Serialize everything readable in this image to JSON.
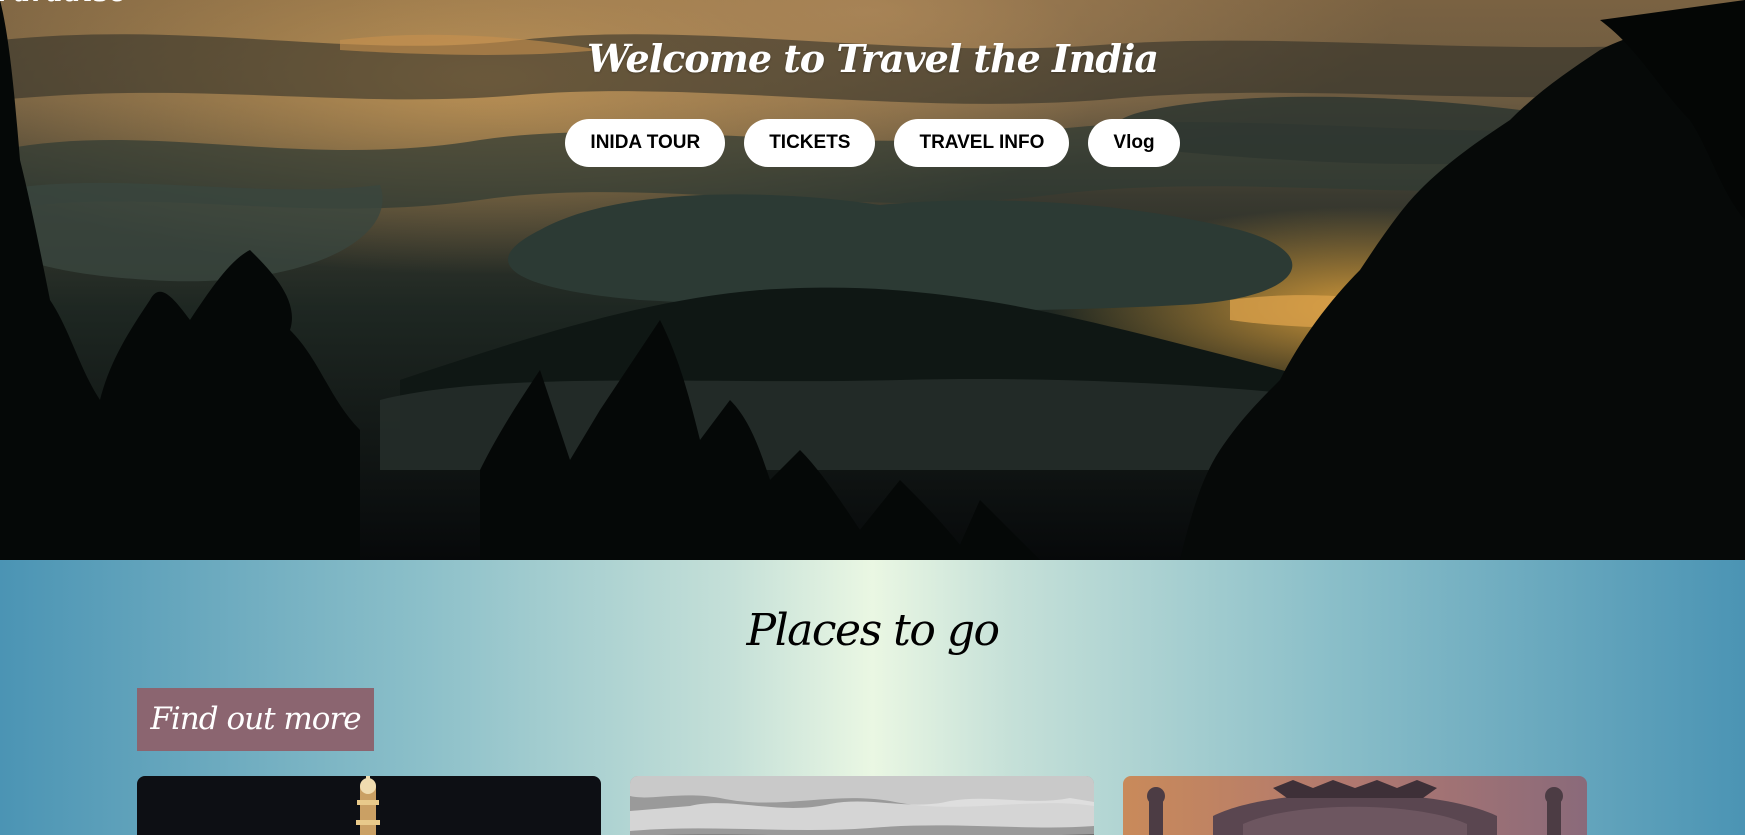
{
  "header": {
    "brand_fragment": "Paradise",
    "title": "Welcome to Travel the India"
  },
  "nav": {
    "items": [
      {
        "label": "INIDA TOUR",
        "name": "nav-india-tour"
      },
      {
        "label": "TICKETS",
        "name": "nav-tickets"
      },
      {
        "label": "TRAVEL INFO",
        "name": "nav-travel-info"
      },
      {
        "label": "Vlog",
        "name": "nav-vlog"
      }
    ]
  },
  "places": {
    "title": "Places to go",
    "find_more_label": "Find out more"
  },
  "colors": {
    "hero_overlay": "#0e1512",
    "sunset": "#d9a04a",
    "button_bg": "#ffffff",
    "find_more_bg": "#8b6570",
    "gradient_edge": "#4b94b4",
    "gradient_center": "#eaf7e3"
  }
}
